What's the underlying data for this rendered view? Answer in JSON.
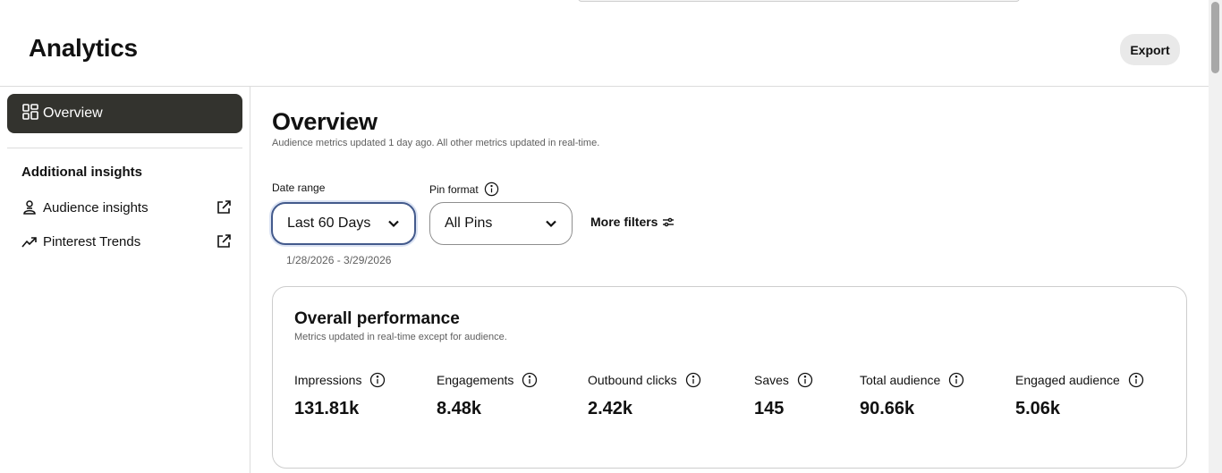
{
  "header": {
    "title": "Analytics",
    "export_label": "Export"
  },
  "sidebar": {
    "overview_label": "Overview",
    "section_title": "Additional insights",
    "links": [
      {
        "label": "Audience insights",
        "icon": "person-icon"
      },
      {
        "label": "Pinterest Trends",
        "icon": "trend-up-icon"
      }
    ]
  },
  "main": {
    "title": "Overview",
    "subtitle": "Audience metrics updated 1 day ago. All other metrics updated in real-time.",
    "filters": {
      "date_range_label": "Date range",
      "date_range_value": "Last 60 Days",
      "date_span": "1/28/2026 - 3/29/2026",
      "pin_format_label": "Pin format",
      "pin_format_value": "All Pins",
      "more_filters_label": "More filters"
    },
    "performance": {
      "title": "Overall performance",
      "subtitle": "Metrics updated in real-time except for audience.",
      "metrics": [
        {
          "label": "Impressions",
          "value": "131.81k"
        },
        {
          "label": "Engagements",
          "value": "8.48k"
        },
        {
          "label": "Outbound clicks",
          "value": "2.42k"
        },
        {
          "label": "Saves",
          "value": "145"
        },
        {
          "label": "Total audience",
          "value": "90.66k"
        },
        {
          "label": "Engaged audience",
          "value": "5.06k"
        }
      ]
    }
  },
  "colors": {
    "nav_active_bg": "#33332e",
    "focus_border": "#435a8c",
    "export_bg": "#e9e9e9"
  }
}
